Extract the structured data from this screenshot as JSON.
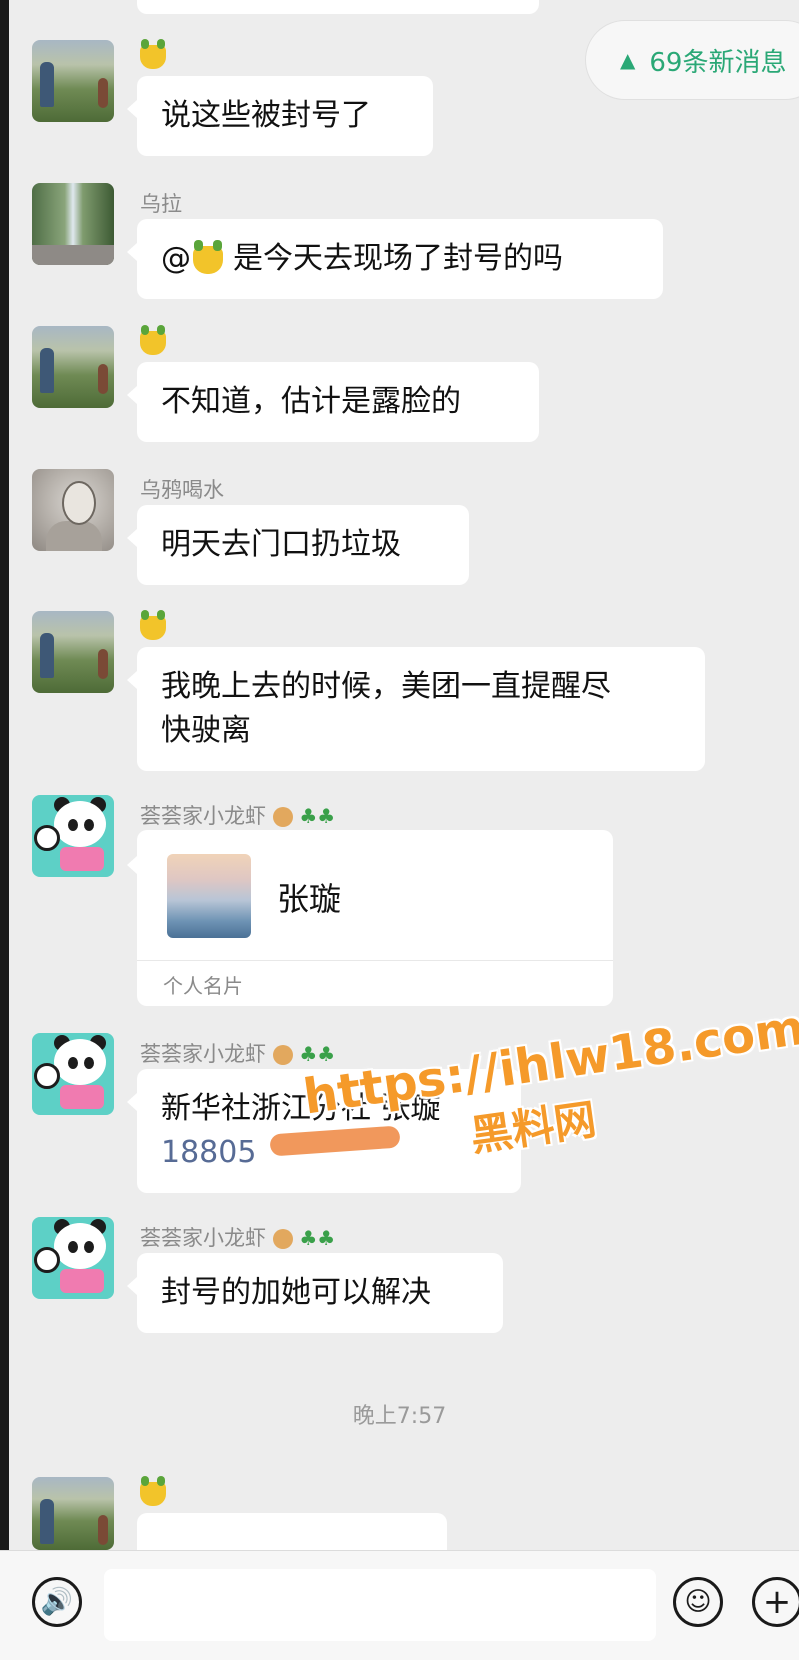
{
  "new_messages": {
    "icon": "double-chevron-up-icon",
    "label": "69条新消息"
  },
  "messages": [
    {
      "sender": "",
      "text": "说这些被封号了"
    },
    {
      "sender": "乌拉",
      "text": "是今天去现场了封号的吗"
    },
    {
      "sender": "",
      "text": "不知道，估计是露脸的"
    },
    {
      "sender": "乌鸦喝水",
      "text": "明天去门口扔垃圾"
    },
    {
      "sender": "",
      "text_line1": "我晚上去的时候，美团一直提醒尽",
      "text_line2": "快驶离"
    },
    {
      "sender": "荟荟家小龙虾",
      "card_name": "张璇",
      "card_type": "个人名片"
    },
    {
      "sender": "荟荟家小龙虾",
      "text_line1": "新华社浙江分社 张璇",
      "phone": "18805"
    },
    {
      "sender": "荟荟家小龙虾",
      "text": "封号的加她可以解决"
    }
  ],
  "timestamp": "晚上7:57",
  "watermark": {
    "url": "https://ihlw18.com",
    "text": "黑料网"
  },
  "input_bar": {
    "voice_icon": "voice-icon",
    "emoji_icon": "emoji-icon",
    "plus_icon": "plus-icon",
    "placeholder": ""
  },
  "colors": {
    "background": "#ededed",
    "bubble": "#ffffff",
    "accent_green": "#2aa876",
    "link_blue": "#576b95",
    "watermark_orange": "#f59a2a"
  }
}
